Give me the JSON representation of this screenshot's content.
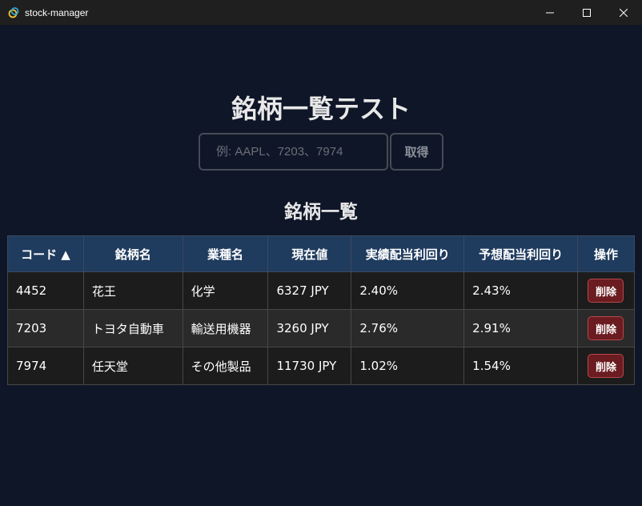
{
  "window": {
    "title": "stock-manager",
    "controls": [
      "minimize-icon",
      "maximize-icon",
      "close-icon"
    ]
  },
  "page": {
    "title": "銘柄一覧テスト",
    "search": {
      "placeholder": "例: AAPL、7203、7974",
      "value": ""
    },
    "fetch_label": "取得",
    "section_title": "銘柄一覧"
  },
  "table": {
    "headers": [
      "コード ▲",
      "銘柄名",
      "業種名",
      "現在値",
      "実績配当利回り",
      "予想配当利回り",
      "操作"
    ],
    "rows": [
      {
        "code": "4452",
        "name": "花王",
        "industry": "化学",
        "price": "6327 JPY",
        "actual_yield": "2.40%",
        "forecast_yield": "2.43%",
        "action": "削除"
      },
      {
        "code": "7203",
        "name": "トヨタ自動車",
        "industry": "輸送用機器",
        "price": "3260 JPY",
        "actual_yield": "2.76%",
        "forecast_yield": "2.91%",
        "action": "削除"
      },
      {
        "code": "7974",
        "name": "任天堂",
        "industry": "その他製品",
        "price": "11730 JPY",
        "actual_yield": "1.02%",
        "forecast_yield": "1.54%",
        "action": "削除"
      }
    ]
  },
  "colors": {
    "background": "#0f1628",
    "header_bg": "#1f3b5e",
    "delete_bg": "#6a1c20",
    "delete_border": "#b8474d"
  }
}
